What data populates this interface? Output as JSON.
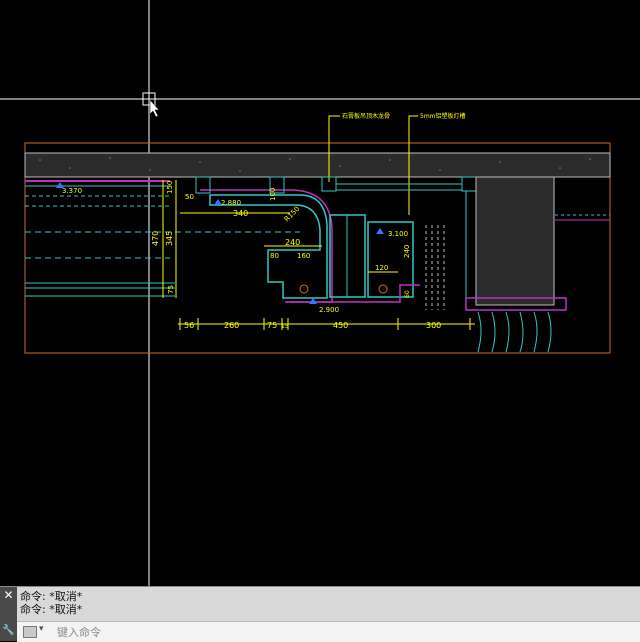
{
  "drawing": {
    "annotations": {
      "leader_1": "石膏板吊顶木龙骨",
      "leader_2": "5mm铝塑板灯槽",
      "elev_1": "3.370",
      "elev_2": "2.880",
      "elev_3": "3.100",
      "elev_4": "2.900"
    },
    "dimensions": {
      "h_bottom": [
        "56",
        "260",
        "75",
        "15",
        "450",
        "300"
      ],
      "v_left": [
        "150",
        "345",
        "470",
        "75"
      ],
      "misc": [
        "50",
        "340",
        "100",
        "R150",
        "240",
        "80",
        "160",
        "120",
        "240",
        "60"
      ]
    }
  },
  "command_line": {
    "history": [
      "命令: *取消*",
      "命令: *取消*"
    ],
    "placeholder": "键入命令",
    "close_glyph": "✕",
    "tool_glyph": "🔧"
  },
  "colors": {
    "background": "#000000",
    "orange": "#d46a1f",
    "yellow": "#ffff00",
    "cyan": "#30c8c8",
    "magenta": "#c030c0",
    "blue": "#2a7bff",
    "grey": "#9a9a9a"
  }
}
